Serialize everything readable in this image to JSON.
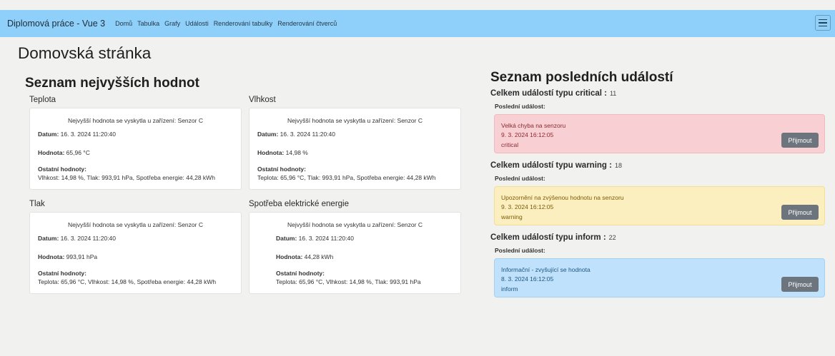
{
  "navbar": {
    "brand": "Diplomová práce - Vue 3",
    "links": [
      "Domů",
      "Tabulka",
      "Grafy",
      "Události",
      "Renderování tabulky",
      "Renderování čtverců"
    ]
  },
  "page_title": "Domovská stránka",
  "highest": {
    "title": "Seznam nejvyšších hodnot",
    "labels": {
      "date": "Datum:",
      "value": "Hodnota:",
      "other": "Ostatní hodnoty:"
    },
    "cards": [
      {
        "title": "Teplota",
        "heading": "Nejvyšší hodnota se vyskytla u zařízení: Senzor C",
        "date": "16. 3. 2024 11:20:40",
        "value": "65,96 °C",
        "other": "Vlhkost: 14,98 %, Tlak: 993,91 hPa, Spotřeba energie: 44,28 kWh"
      },
      {
        "title": "Vlhkost",
        "heading": "Nejvyšší hodnota se vyskytla u zařízení: Senzor C",
        "date": "16. 3. 2024 11:20:40",
        "value": "14,98 %",
        "other": "Teplota: 65,96 °C, Tlak: 993,91 hPa, Spotřeba energie: 44,28 kWh"
      },
      {
        "title": "Tlak",
        "heading": "Nejvyšší hodnota se vyskytla u zařízení: Senzor C",
        "date": "16. 3. 2024 11:20:40",
        "value": "993,91 hPa",
        "other": "Teplota: 65,96 °C, Vlhkost: 14,98 %, Spotřeba energie: 44,28 kWh"
      },
      {
        "title": "Spotřeba elektrické energie",
        "heading": "Nejvyšší hodnota se vyskytla u zařízení: Senzor C",
        "date": "16. 3. 2024 11:20:40",
        "value": "44,28 kWh",
        "other": "Teplota: 65,96 °C, Vlhkost: 14,98 %, Tlak: 993,91 hPa"
      }
    ]
  },
  "events": {
    "title": "Seznam posledních událostí",
    "last_label": "Poslední událost:",
    "accept_label": "Přijmout",
    "groups": [
      {
        "heading": "Celkem událostí typu critical :",
        "count": "11",
        "message": "Velká chyba na senzoru",
        "time": "9. 3. 2024 16:12:05",
        "type": "critical",
        "color": "#f8d0d3"
      },
      {
        "heading": "Celkem událostí typu warning :",
        "count": "18",
        "message": "Upozornění na zvýšenou hodnotu na senzoru",
        "time": "9. 3. 2024 16:12:05",
        "type": "warning",
        "color": "#fcefbf"
      },
      {
        "heading": "Celkem událostí typu inform :",
        "count": "22",
        "message": "Informační - zvyšující se hodnota",
        "time": "8. 3. 2024 16:12:05",
        "type": "inform",
        "color": "#bfe1fb"
      }
    ]
  },
  "colors": {
    "navbar": "#8fd0fb",
    "button": "#6c757d"
  }
}
